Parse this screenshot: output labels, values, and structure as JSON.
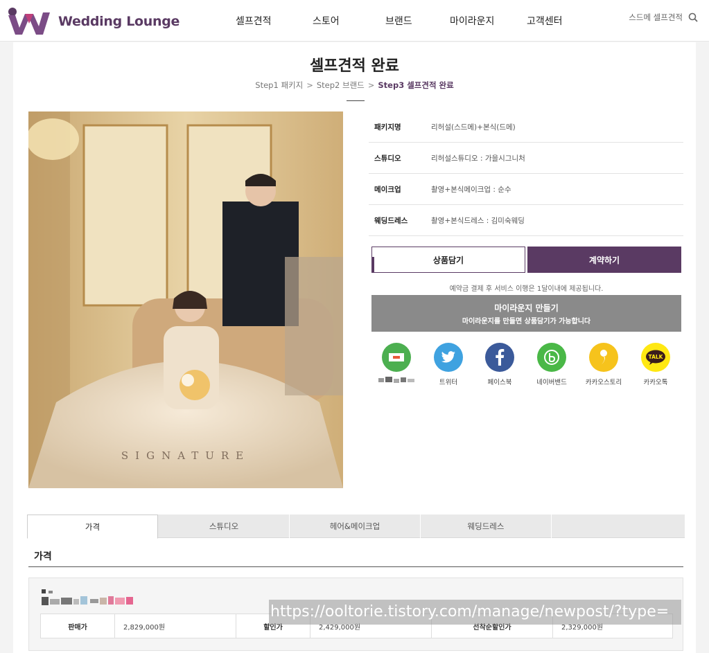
{
  "header": {
    "logo_text": "Wedding Lounge",
    "nav": [
      "셀프견적",
      "스토어",
      "브랜드",
      "마이라운지",
      "고객센터"
    ],
    "search_placeholder": "스드메 셀프견적"
  },
  "page": {
    "title": "셀프견적 완료",
    "breadcrumb": [
      "Step1 패키지",
      "Step2 브랜드",
      "Step3 셀프견적 완료"
    ],
    "breadcrumb_sep": ">"
  },
  "photo": {
    "watermark_text": "SIGNATURE"
  },
  "info": [
    {
      "label": "패키지명",
      "value": "리허설(스드메)+본식(드메)"
    },
    {
      "label": "스튜디오",
      "value": "리허설스튜디오 : 가을시그니처"
    },
    {
      "label": "메이크업",
      "value": "촬영+본식메이크업 : 순수"
    },
    {
      "label": "웨딩드레스",
      "value": "촬영+본식드레스 : 김미숙웨딩"
    }
  ],
  "actions": {
    "cart_label": "상품담기",
    "contract_label": "계약하기",
    "notice": "예약금 결제 후 서비스 이행은 1달이내에 제공됩니다.",
    "lounge_title": "마이라운지 만들기",
    "lounge_sub": "마이라운지를 만들면 상품담기가 가능합니다"
  },
  "share": [
    {
      "label": "",
      "icon": "blurred-share-icon",
      "color": "#4caf50"
    },
    {
      "label": "트위터",
      "icon": "twitter-icon",
      "color": "#3fa2e0"
    },
    {
      "label": "페이스북",
      "icon": "facebook-icon",
      "color": "#3b5a9a"
    },
    {
      "label": "네이버밴드",
      "icon": "naver-band-icon",
      "color": "#4ab847"
    },
    {
      "label": "카카오스토리",
      "icon": "kakao-story-icon",
      "color": "#f6c31c"
    },
    {
      "label": "카카오톡",
      "icon": "kakao-talk-icon",
      "color": "#ffe812"
    }
  ],
  "tabs": [
    "가격",
    "스튜디오",
    "헤어&메이크업",
    "웨딩드레스"
  ],
  "price": {
    "section_title": "가격",
    "cells": [
      {
        "label": "판매가",
        "value": "2,829,000원"
      },
      {
        "label": "할인가",
        "value": "2,429,000원"
      },
      {
        "label": "선착순할인가",
        "value": "2,329,000원"
      }
    ]
  },
  "overlay": {
    "url_text": "https://ooltorie.tistory.com/manage/newpost/?type="
  },
  "colors": {
    "brand": "#5a3a63",
    "lounge_button": "#8a8a8a"
  }
}
